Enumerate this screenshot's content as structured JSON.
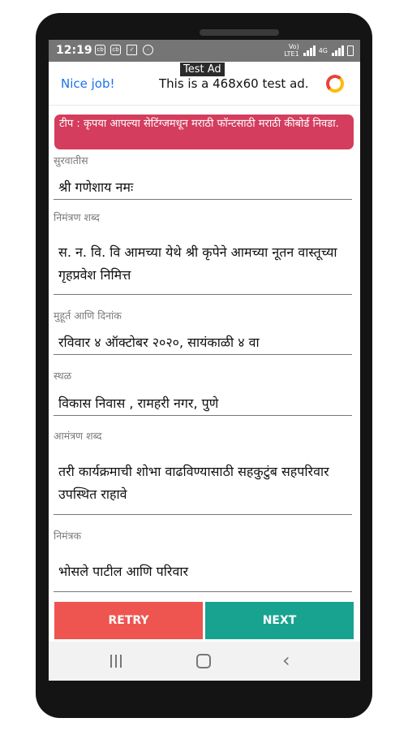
{
  "status_bar": {
    "time": "12:19",
    "icons": [
      "cb-icon",
      "cb-icon",
      "clipboard-icon",
      "hotspot-icon"
    ],
    "network": [
      "Vo)",
      "LTE1"
    ],
    "signal": "4G"
  },
  "ad": {
    "badge": "Test Ad",
    "headline": "Nice job!",
    "body": "This is a 468x60 test ad."
  },
  "tip": "टीप : कृपया आपल्या सेटिंग्जमधून मराठी फॉन्टसाठी मराठी कीबोर्ड निवडा.",
  "fields": [
    {
      "label": "सुरवातीस",
      "value": "श्री गणेशाय नमः"
    },
    {
      "label": "निमंत्रण शब्द",
      "value": "स. न. वि. वि आमच्या येथे श्री कृपेने आमच्या नूतन वास्तूच्या गृहप्रवेश निमित्त"
    },
    {
      "label": "मुहूर्त आणि दिनांक",
      "value": "रविवार ४ ऑक्टोबर २०२०, सायंकाळी ४ वा"
    },
    {
      "label": "स्थळ",
      "value": "विकास निवास , रामहरी नगर, पुणे"
    },
    {
      "label": "आमंत्रण शब्द",
      "value": "तरी कार्यक्रमाची शोभा वाढविण्यासाठी सहकुटुंब सहपरिवार उपस्थित राहावे"
    },
    {
      "label": "निमंत्रक",
      "value": "भोसले पाटील आणि परिवार"
    }
  ],
  "buttons": {
    "retry": "RETRY",
    "next": "NEXT"
  },
  "colors": {
    "retry": "#ee5550",
    "next": "#18a391",
    "tip": "#d43d5d",
    "status_bar": "#757575"
  }
}
